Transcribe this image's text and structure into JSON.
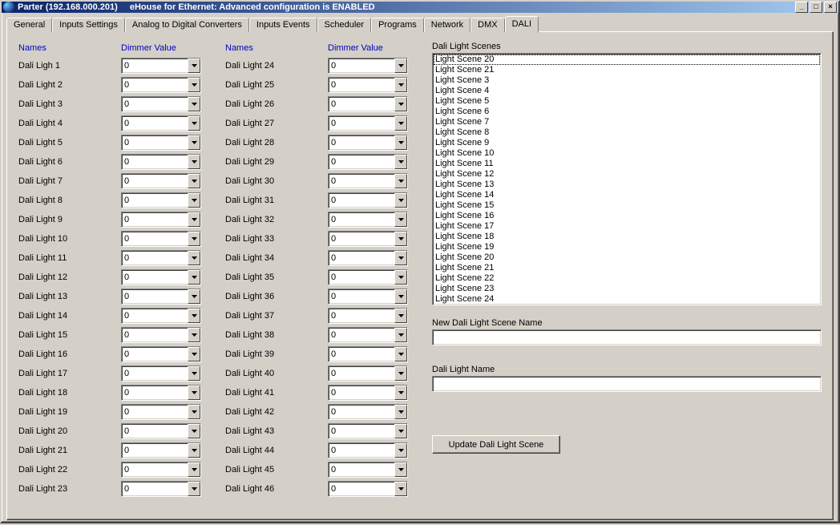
{
  "window": {
    "title_left": "Parter (192.168.000.201)",
    "title_right": "eHouse for Ethernet: Advanced configuration is ENABLED"
  },
  "tabs": [
    "General",
    "Inputs Settings",
    "Analog to Digital Converters",
    "Inputs Events",
    "Scheduler",
    "Programs",
    "Network",
    "DMX",
    "DALI"
  ],
  "active_tab": "DALI",
  "headers": {
    "names": "Names",
    "dimmer": "Dimmer Value"
  },
  "lights_left": [
    {
      "name": "Dali Ligh 1",
      "value": "0"
    },
    {
      "name": "Dali Light 2",
      "value": "0"
    },
    {
      "name": "Dali Light 3",
      "value": "0"
    },
    {
      "name": "Dali Light 4",
      "value": "0"
    },
    {
      "name": "Dali Light 5",
      "value": "0"
    },
    {
      "name": "Dali Light 6",
      "value": "0"
    },
    {
      "name": "Dali Light 7",
      "value": "0"
    },
    {
      "name": "Dali Light 8",
      "value": "0"
    },
    {
      "name": "Dali Light 9",
      "value": "0"
    },
    {
      "name": "Dali Light 10",
      "value": "0"
    },
    {
      "name": "Dali Light 11",
      "value": "0"
    },
    {
      "name": "Dali Light 12",
      "value": "0"
    },
    {
      "name": "Dali Light 13",
      "value": "0"
    },
    {
      "name": "Dali Light 14",
      "value": "0"
    },
    {
      "name": "Dali Light 15",
      "value": "0"
    },
    {
      "name": "Dali Light 16",
      "value": "0"
    },
    {
      "name": "Dali Light 17",
      "value": "0"
    },
    {
      "name": "Dali Light 18",
      "value": "0"
    },
    {
      "name": "Dali Light 19",
      "value": "0"
    },
    {
      "name": "Dali Light 20",
      "value": "0"
    },
    {
      "name": "Dali Light 21",
      "value": "0"
    },
    {
      "name": "Dali Light 22",
      "value": "0"
    },
    {
      "name": "Dali Light 23",
      "value": "0"
    }
  ],
  "lights_right": [
    {
      "name": "Dali Light 24",
      "value": "0"
    },
    {
      "name": "Dali Light 25",
      "value": "0"
    },
    {
      "name": "Dali Light 26",
      "value": "0"
    },
    {
      "name": "Dali Light 27",
      "value": "0"
    },
    {
      "name": "Dali Light 28",
      "value": "0"
    },
    {
      "name": "Dali Light 29",
      "value": "0"
    },
    {
      "name": "Dali Light 30",
      "value": "0"
    },
    {
      "name": "Dali Light 31",
      "value": "0"
    },
    {
      "name": "Dali Light 32",
      "value": "0"
    },
    {
      "name": "Dali Light 33",
      "value": "0"
    },
    {
      "name": "Dali Light 34",
      "value": "0"
    },
    {
      "name": "Dali Light 35",
      "value": "0"
    },
    {
      "name": "Dali Light 36",
      "value": "0"
    },
    {
      "name": "Dali Light 37",
      "value": "0"
    },
    {
      "name": "Dali Light 38",
      "value": "0"
    },
    {
      "name": "Dali Light 39",
      "value": "0"
    },
    {
      "name": "Dali Light 40",
      "value": "0"
    },
    {
      "name": "Dali Light 41",
      "value": "0"
    },
    {
      "name": "Dali Light 42",
      "value": "0"
    },
    {
      "name": "Dali Light 43",
      "value": "0"
    },
    {
      "name": "Dali Light 44",
      "value": "0"
    },
    {
      "name": "Dali Light 45",
      "value": "0"
    },
    {
      "name": "Dali Light 46",
      "value": "0"
    }
  ],
  "scenes": {
    "label": "Dali Light Scenes",
    "selected_index": 0,
    "items": [
      "Light Scene 20",
      "Light Scene 21",
      "Light Scene 3",
      "Light Scene 4",
      "Light Scene 5",
      "Light Scene 6",
      "Light Scene 7",
      "Light Scene 8",
      "Light Scene 9",
      "Light Scene 10",
      "Light Scene 11",
      "Light Scene 12",
      "Light Scene 13",
      "Light Scene 14",
      "Light Scene 15",
      "Light Scene 16",
      "Light Scene 17",
      "Light Scene 18",
      "Light Scene 19",
      "Light Scene 20",
      "Light Scene 21",
      "Light Scene 22",
      "Light Scene 23",
      "Light Scene 24"
    ]
  },
  "new_scene_label": "New Dali Light Scene Name",
  "new_scene_value": "",
  "light_name_label": "Dali Light Name",
  "light_name_value": "",
  "update_button": "Update Dali Light Scene"
}
